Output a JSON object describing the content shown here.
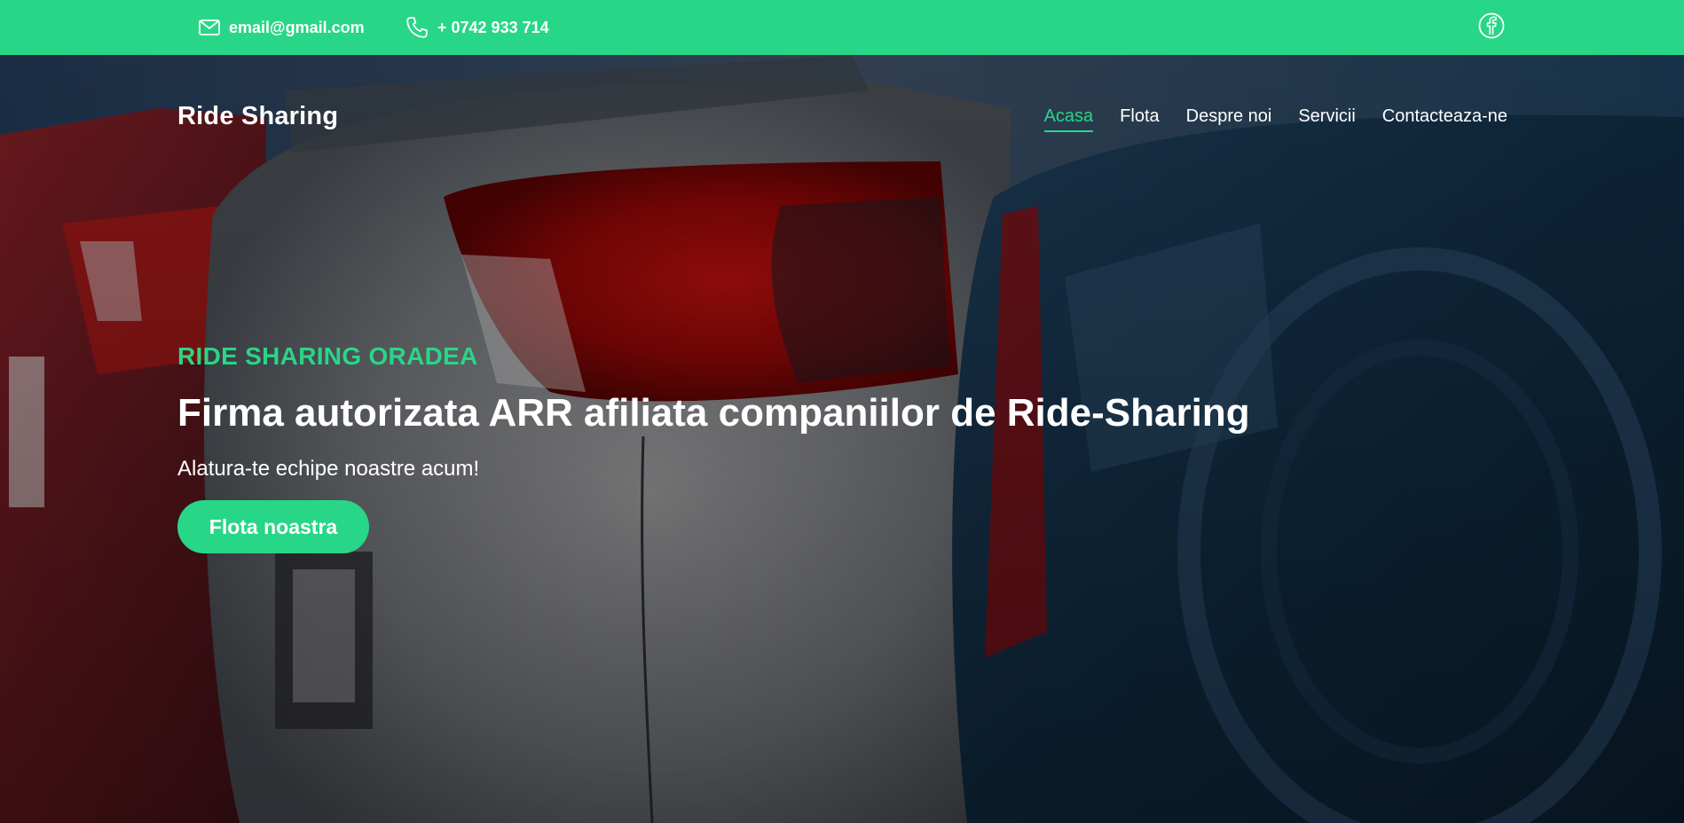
{
  "topbar": {
    "email": "email@gmail.com",
    "phone": "+ 0742 933 714",
    "email_icon": "envelope-icon",
    "phone_icon": "phone-icon",
    "social_icon": "facebook-icon"
  },
  "header": {
    "brand": "Ride Sharing",
    "nav": [
      {
        "label": "Acasa",
        "active": true
      },
      {
        "label": "Flota",
        "active": false
      },
      {
        "label": "Despre noi",
        "active": false
      },
      {
        "label": "Servicii",
        "active": false
      },
      {
        "label": "Contacteaza-ne",
        "active": false
      }
    ]
  },
  "hero": {
    "eyebrow": "RIDE SHARING ORADEA",
    "headline": "Firma autorizata ARR afiliata companiilor de Ride-Sharing",
    "subline": "Alatura-te echipe noastre acum!",
    "cta_label": "Flota noastra"
  },
  "colors": {
    "accent": "#28d687",
    "text_light": "#ffffff"
  }
}
